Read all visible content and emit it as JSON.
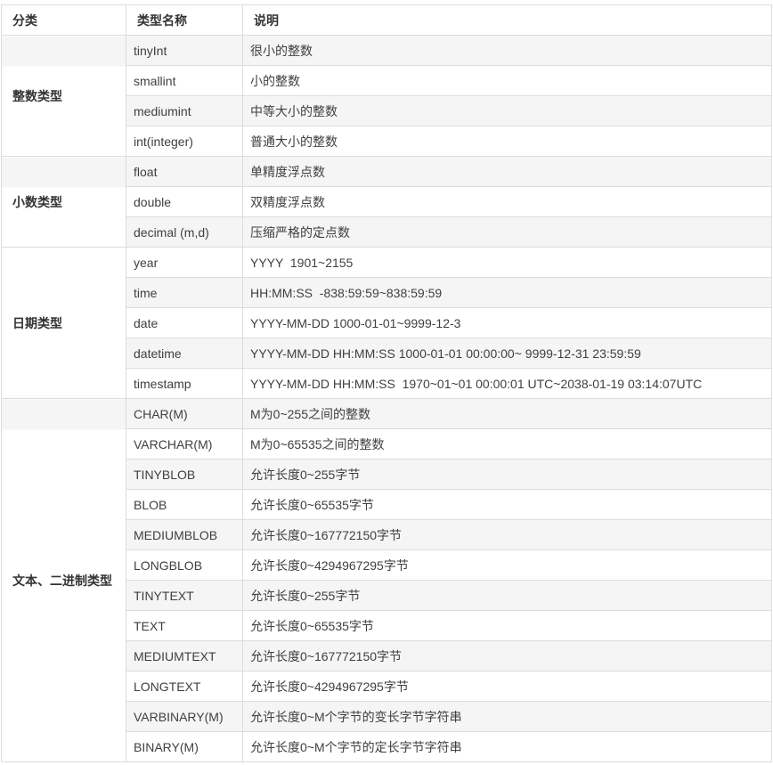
{
  "colors": {
    "stripe": "#f5f5f6",
    "border": "#dcdcdc",
    "text": "#3f3f3f",
    "heading_text": "#333333"
  },
  "table": {
    "headers": [
      "分类",
      "类型名称",
      "说明"
    ],
    "groups": [
      {
        "category": "整数类型",
        "rows": [
          {
            "type": "tinyInt",
            "desc": "很小的整数"
          },
          {
            "type": "smallint",
            "desc": "小的整数"
          },
          {
            "type": "mediumint",
            "desc": "中等大小的整数"
          },
          {
            "type": "int(integer)",
            "desc": "普通大小的整数"
          }
        ]
      },
      {
        "category": "小数类型",
        "rows": [
          {
            "type": "float",
            "desc": "单精度浮点数"
          },
          {
            "type": "double",
            "desc": "双精度浮点数"
          },
          {
            "type": "decimal (m,d)",
            "desc": "压缩严格的定点数"
          }
        ]
      },
      {
        "category": "日期类型",
        "rows": [
          {
            "type": "year",
            "desc": "YYYY  1901~2155"
          },
          {
            "type": "time",
            "desc": "HH:MM:SS  -838:59:59~838:59:59"
          },
          {
            "type": "date",
            "desc": "YYYY-MM-DD 1000-01-01~9999-12-3"
          },
          {
            "type": "datetime",
            "desc": "YYYY-MM-DD HH:MM:SS 1000-01-01 00:00:00~ 9999-12-31 23:59:59"
          },
          {
            "type": "timestamp",
            "desc": "YYYY-MM-DD HH:MM:SS  1970~01~01 00:00:01 UTC~2038-01-19 03:14:07UTC"
          }
        ]
      },
      {
        "category": "文本、二进制类型",
        "rows": [
          {
            "type": "CHAR(M)",
            "desc": "M为0~255之间的整数"
          },
          {
            "type": "VARCHAR(M)",
            "desc": "M为0~65535之间的整数"
          },
          {
            "type": "TINYBLOB",
            "desc": "允许长度0~255字节"
          },
          {
            "type": "BLOB",
            "desc": "允许长度0~65535字节"
          },
          {
            "type": "MEDIUMBLOB",
            "desc": "允许长度0~167772150字节"
          },
          {
            "type": "LONGBLOB",
            "desc": "允许长度0~4294967295字节"
          },
          {
            "type": "TINYTEXT",
            "desc": "允许长度0~255字节"
          },
          {
            "type": "TEXT",
            "desc": "允许长度0~65535字节"
          },
          {
            "type": "MEDIUMTEXT",
            "desc": "允许长度0~167772150字节"
          },
          {
            "type": "LONGTEXT",
            "desc": "允许长度0~4294967295字节"
          },
          {
            "type": "VARBINARY(M)",
            "desc": "允许长度0~M个字节的变长字节字符串"
          },
          {
            "type": "BINARY(M)",
            "desc": "允许长度0~M个字节的定长字节字符串"
          }
        ]
      }
    ]
  }
}
